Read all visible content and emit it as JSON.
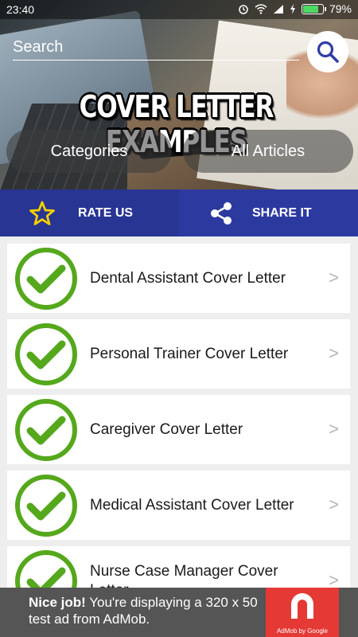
{
  "status_bar": {
    "time": "23:40",
    "battery": "79%",
    "battery_level": 0.79
  },
  "header": {
    "search_placeholder": "Search",
    "title": "COVER LETTER EXAMPLES",
    "categories_label": "Categories",
    "all_articles_label": "All Articles"
  },
  "actions": {
    "rate_label": "RATE US",
    "share_label": "SHARE IT"
  },
  "list": {
    "items": [
      {
        "label": "Dental Assistant Cover Letter"
      },
      {
        "label": "Personal Trainer Cover Letter"
      },
      {
        "label": "Caregiver Cover Letter"
      },
      {
        "label": "Medical Assistant Cover Letter"
      },
      {
        "label": "Nurse Case Manager Cover Letter"
      }
    ],
    "chevron": ">"
  },
  "ad": {
    "headline": "Nice job!",
    "body": " You're displaying a 320 x 50 test ad from AdMob.",
    "logo_caption": "AdMob by Google"
  },
  "colors": {
    "action_bar": "#283593",
    "check_green": "#55a81c",
    "ad_background": "#555555",
    "ad_logo": "#e53935",
    "search_icon": "#2e3da8"
  }
}
